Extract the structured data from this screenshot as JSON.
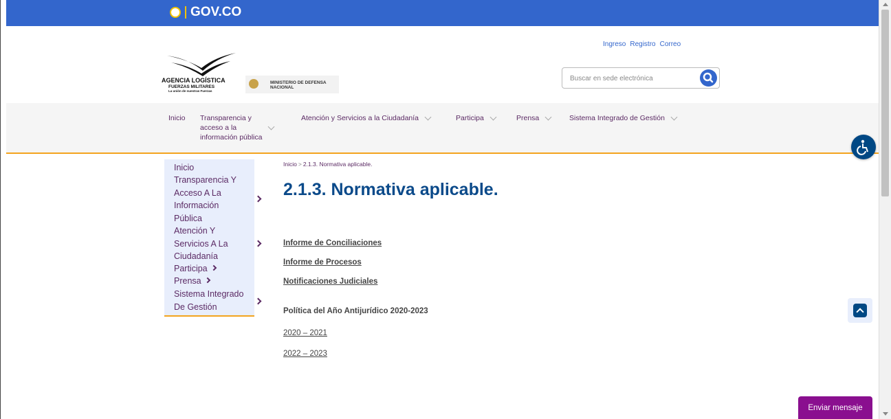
{
  "govbar": {
    "label": "GOV.CO"
  },
  "logo": {
    "agency_line1": "AGENCIA LOGÍSTICA",
    "agency_line2": "FUERZAS MILITARES",
    "agency_tagline": "La unión de nuestras Fuerzas",
    "ministry_line1": "MINISTERIO DE DEFENSA",
    "ministry_line2": "NACIONAL"
  },
  "toplinks": {
    "ingreso": "Ingreso",
    "registro": "Registro",
    "correo": "Correo"
  },
  "search": {
    "placeholder": "Buscar en sede electrónica",
    "icon": "search-icon"
  },
  "nav": {
    "inicio": "Inicio",
    "transparencia_1": "Transparencia y",
    "transparencia_2": "acceso a la",
    "transparencia_3": "información pública",
    "atencion": "Atención y Servicios a la Ciudadanía",
    "participa": "Participa",
    "prensa": "Prensa",
    "sig": "Sistema Integrado de Gestión"
  },
  "sidebar": {
    "inicio": "Inicio",
    "transparencia": [
      "Transparencia Y",
      "Acceso A La",
      "Información",
      "Pública"
    ],
    "atencion": [
      "Atención Y",
      "Servicios A La",
      "Ciudadanía"
    ],
    "participa": "Participa",
    "prensa": "Prensa",
    "sig": [
      "Sistema Integrado",
      "De Gestión"
    ]
  },
  "breadcrumb": {
    "home": "Inicio",
    "separator": ">",
    "current": "2.1.3. Normativa aplicable."
  },
  "page": {
    "title": "2.1.3. Normativa aplicable.",
    "links": [
      "Informe de Conciliaciones",
      "Informe de Procesos",
      "Notificaciones Judiciales"
    ],
    "section_title": "Política del Año Antijurídico 2020-2023",
    "year_links": [
      "2020 – 2021",
      "2022 – 2023"
    ]
  },
  "chat": {
    "label": "Enviar mensaje"
  },
  "colors": {
    "gov_blue": "#3366cc",
    "accent_orange": "#f3a31d",
    "title_blue": "#0b4a8a",
    "nav_purple": "#5b2a64",
    "chat_purple": "#8a0f8f"
  }
}
